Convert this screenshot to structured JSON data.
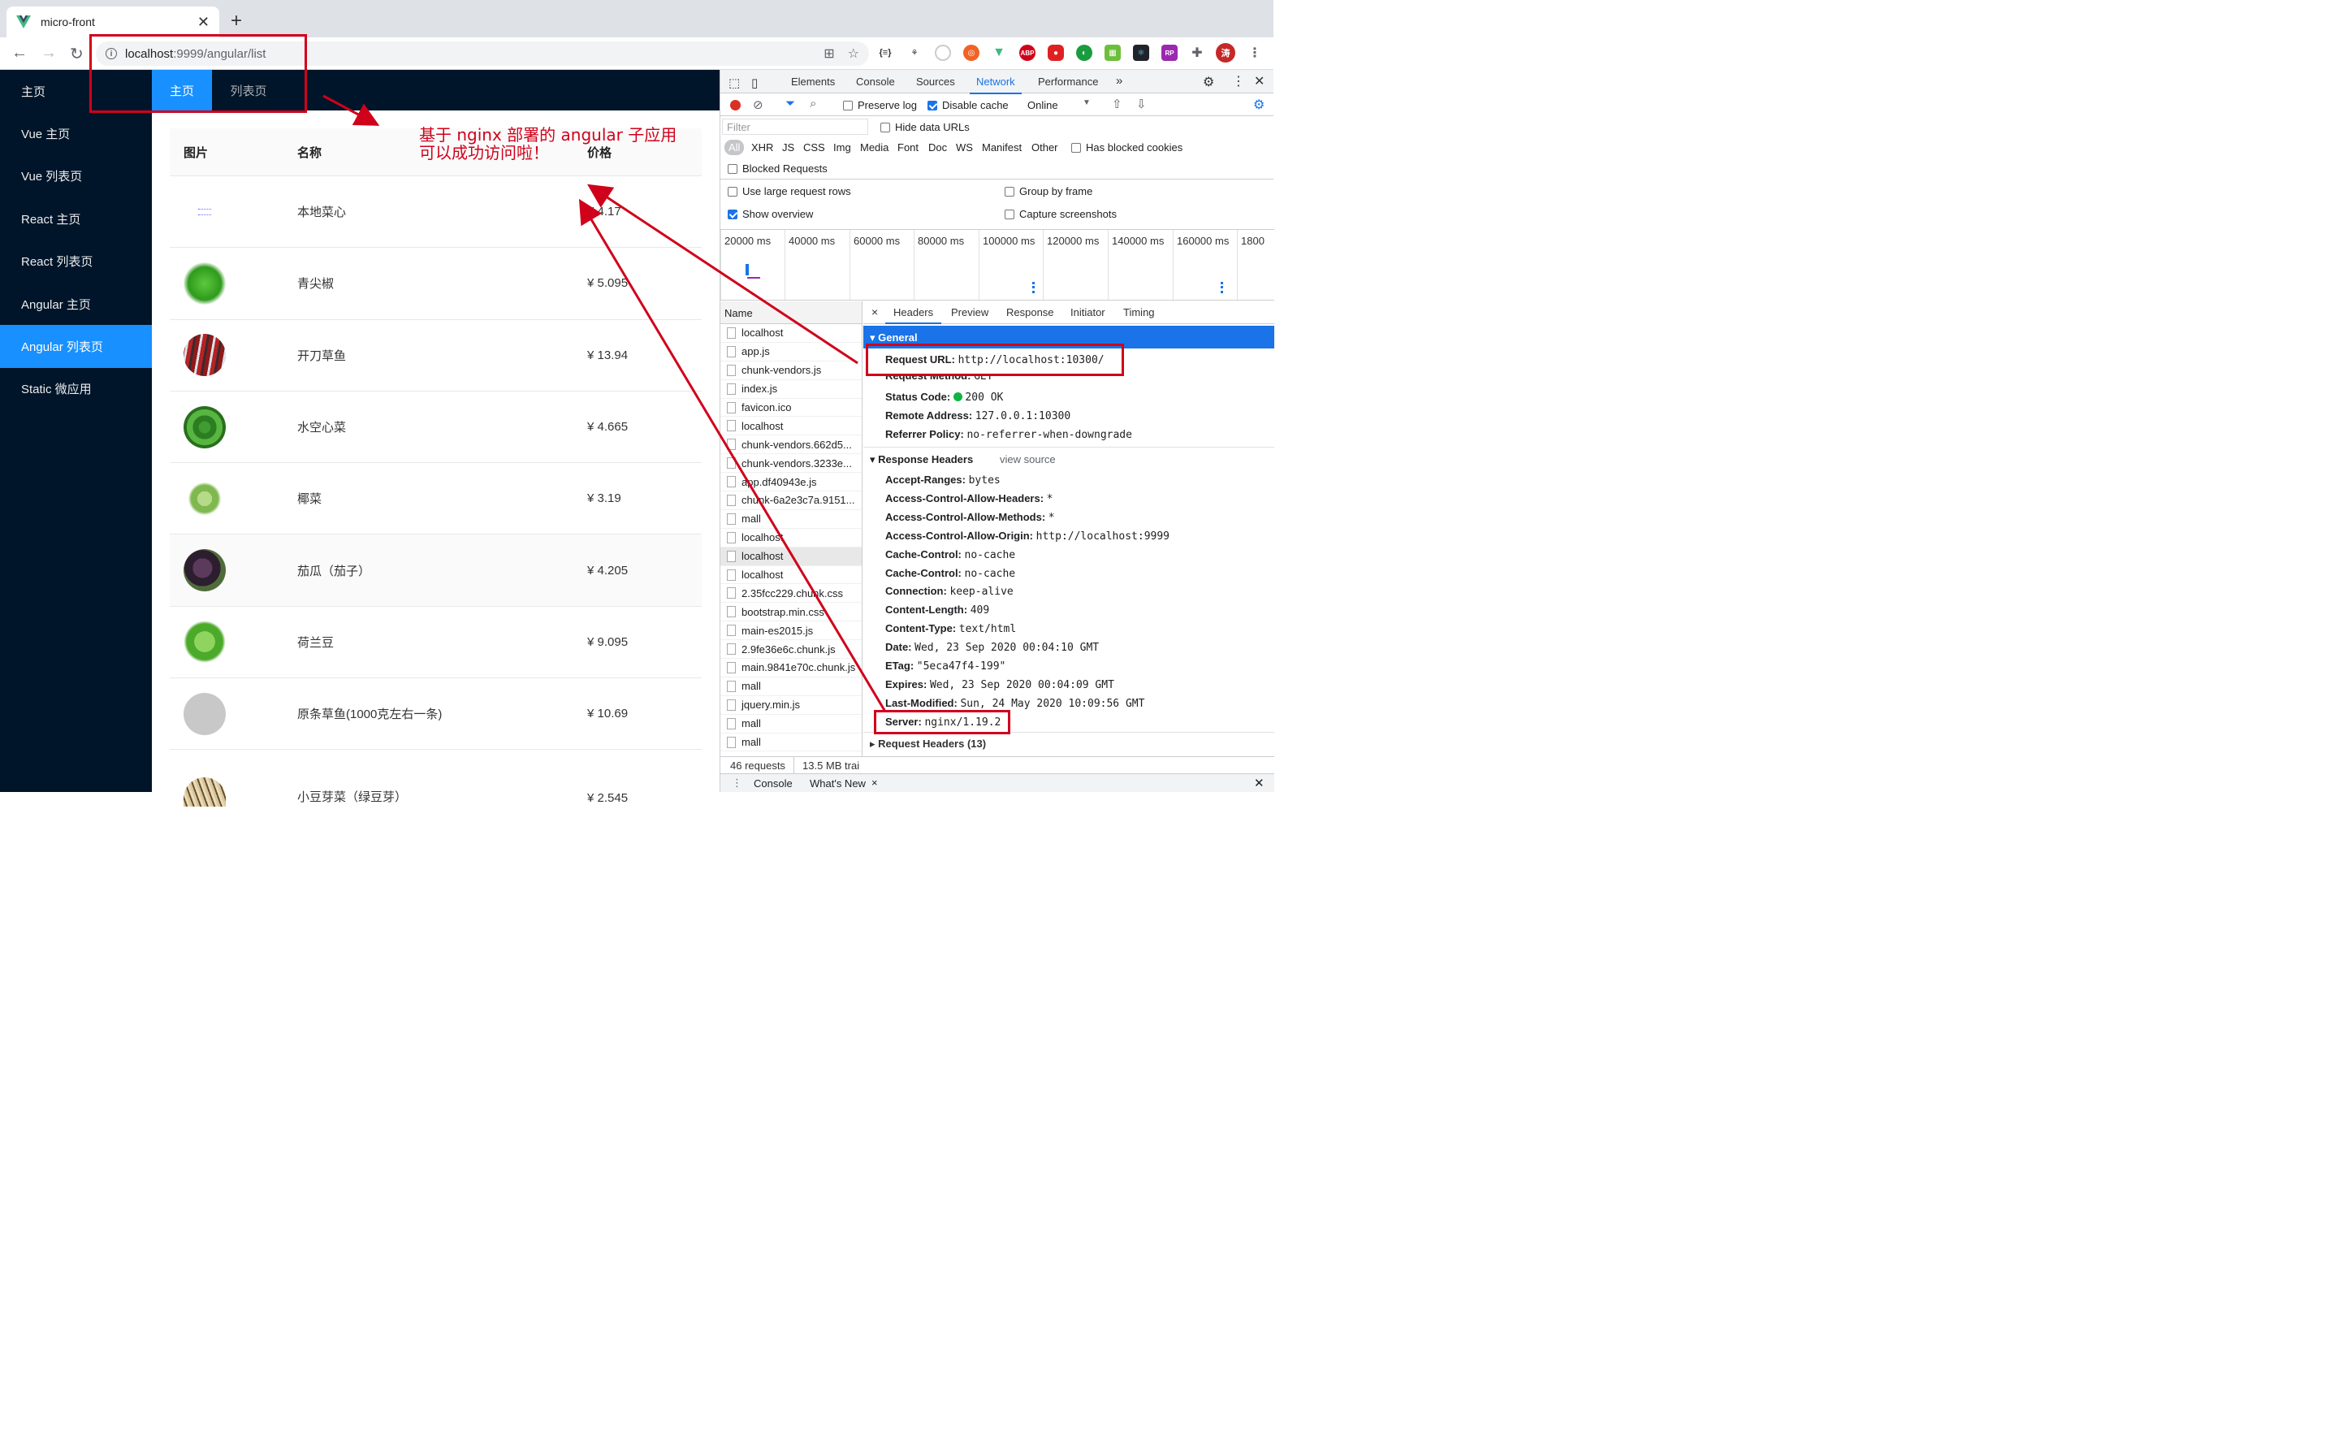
{
  "browser": {
    "tab_title": "micro-front",
    "url_host": "localhost",
    "url_rest": ":9999/angular/list"
  },
  "sidebar": {
    "items": [
      {
        "label": "主页"
      },
      {
        "label": "Vue 主页"
      },
      {
        "label": "Vue 列表页"
      },
      {
        "label": "React 主页"
      },
      {
        "label": "React 列表页"
      },
      {
        "label": "Angular 主页"
      },
      {
        "label": "Angular 列表页",
        "active": true
      },
      {
        "label": "Static 微应用"
      }
    ]
  },
  "topnav": {
    "home": "主页",
    "list": "列表页"
  },
  "table": {
    "headers": {
      "image": "图片",
      "name": "名称",
      "price": "价格"
    },
    "rows": [
      {
        "name": "本地菜心",
        "price": "¥ 4.17"
      },
      {
        "name": "青尖椒",
        "price": "¥ 5.095"
      },
      {
        "name": "开刀草鱼",
        "price": "¥ 13.94"
      },
      {
        "name": "水空心菜",
        "price": "¥ 4.665"
      },
      {
        "name": "椰菜",
        "price": "¥ 3.19"
      },
      {
        "name": "茄瓜（茄子）",
        "price": "¥ 4.205"
      },
      {
        "name": "荷兰豆",
        "price": "¥ 9.095"
      },
      {
        "name": "原条草鱼(1000克左右一条)",
        "price": "¥ 10.69"
      },
      {
        "name": "小豆芽菜（绿豆芽）",
        "price": "¥ 2.545"
      }
    ]
  },
  "annotation": {
    "line1": "基于 nginx 部署的 angular 子应用",
    "line2": "可以成功访问啦！"
  },
  "devtools": {
    "tabs": [
      "Elements",
      "Console",
      "Sources",
      "Network",
      "Performance"
    ],
    "more": "»",
    "preserve_log": "Preserve log",
    "disable_cache": "Disable cache",
    "throttle": "Online",
    "filter_placeholder": "Filter",
    "hide_data_urls": "Hide data URLs",
    "types": [
      "All",
      "XHR",
      "JS",
      "CSS",
      "Img",
      "Media",
      "Font",
      "Doc",
      "WS",
      "Manifest",
      "Other"
    ],
    "has_blocked_cookies": "Has blocked cookies",
    "blocked_requests": "Blocked Requests",
    "use_large_rows": "Use large request rows",
    "group_by_frame": "Group by frame",
    "show_overview": "Show overview",
    "capture_screenshots": "Capture screenshots",
    "timeline_ticks": [
      "20000 ms",
      "40000 ms",
      "60000 ms",
      "80000 ms",
      "100000 ms",
      "120000 ms",
      "140000 ms",
      "160000 ms",
      "1800"
    ],
    "name_header": "Name",
    "requests": [
      "localhost",
      "app.js",
      "chunk-vendors.js",
      "index.js",
      "favicon.ico",
      "localhost",
      "chunk-vendors.662d5...",
      "chunk-vendors.3233e...",
      "app.df40943e.js",
      "chunk-6a2e3c7a.9151...",
      "mall",
      "localhost",
      "localhost",
      "localhost",
      "2.35fcc229.chunk.css",
      "bootstrap.min.css",
      "main-es2015.js",
      "2.9fe36e6c.chunk.js",
      "main.9841e70c.chunk.js",
      "mall",
      "jquery.min.js",
      "mall",
      "mall"
    ],
    "detail_tabs": [
      "Headers",
      "Preview",
      "Response",
      "Initiator",
      "Timing"
    ],
    "general_title": "General",
    "general": [
      {
        "k": "Request URL:",
        "v": "http://localhost:10300/"
      },
      {
        "k": "Request Method:",
        "v": "GET"
      },
      {
        "k": "Status Code:",
        "v": "200 OK"
      },
      {
        "k": "Remote Address:",
        "v": "127.0.0.1:10300"
      },
      {
        "k": "Referrer Policy:",
        "v": "no-referrer-when-downgrade"
      }
    ],
    "response_headers_title": "Response Headers",
    "view_source": "view source",
    "response_headers": [
      {
        "k": "Accept-Ranges:",
        "v": "bytes"
      },
      {
        "k": "Access-Control-Allow-Headers:",
        "v": "*"
      },
      {
        "k": "Access-Control-Allow-Methods:",
        "v": "*"
      },
      {
        "k": "Access-Control-Allow-Origin:",
        "v": "http://localhost:9999"
      },
      {
        "k": "Cache-Control:",
        "v": "no-cache"
      },
      {
        "k": "Cache-Control:",
        "v": "no-cache"
      },
      {
        "k": "Connection:",
        "v": "keep-alive"
      },
      {
        "k": "Content-Length:",
        "v": "409"
      },
      {
        "k": "Content-Type:",
        "v": "text/html"
      },
      {
        "k": "Date:",
        "v": "Wed, 23 Sep 2020 00:04:10 GMT"
      },
      {
        "k": "ETag:",
        "v": "\"5eca47f4-199\""
      },
      {
        "k": "Expires:",
        "v": "Wed, 23 Sep 2020 00:04:09 GMT"
      },
      {
        "k": "Last-Modified:",
        "v": "Sun, 24 May 2020 10:09:56 GMT"
      },
      {
        "k": "Server:",
        "v": "nginx/1.19.2"
      }
    ],
    "request_headers_title": "Request Headers (13)",
    "footer_requests": "46 requests",
    "footer_size": "13.5 MB trai",
    "drawer_console": "Console",
    "drawer_whats_new": "What's New"
  },
  "colors": {
    "sidebar_bg": "#001529",
    "active": "#1890ff",
    "annotation": "#d0021b",
    "devtools_accent": "#1a73e8"
  }
}
